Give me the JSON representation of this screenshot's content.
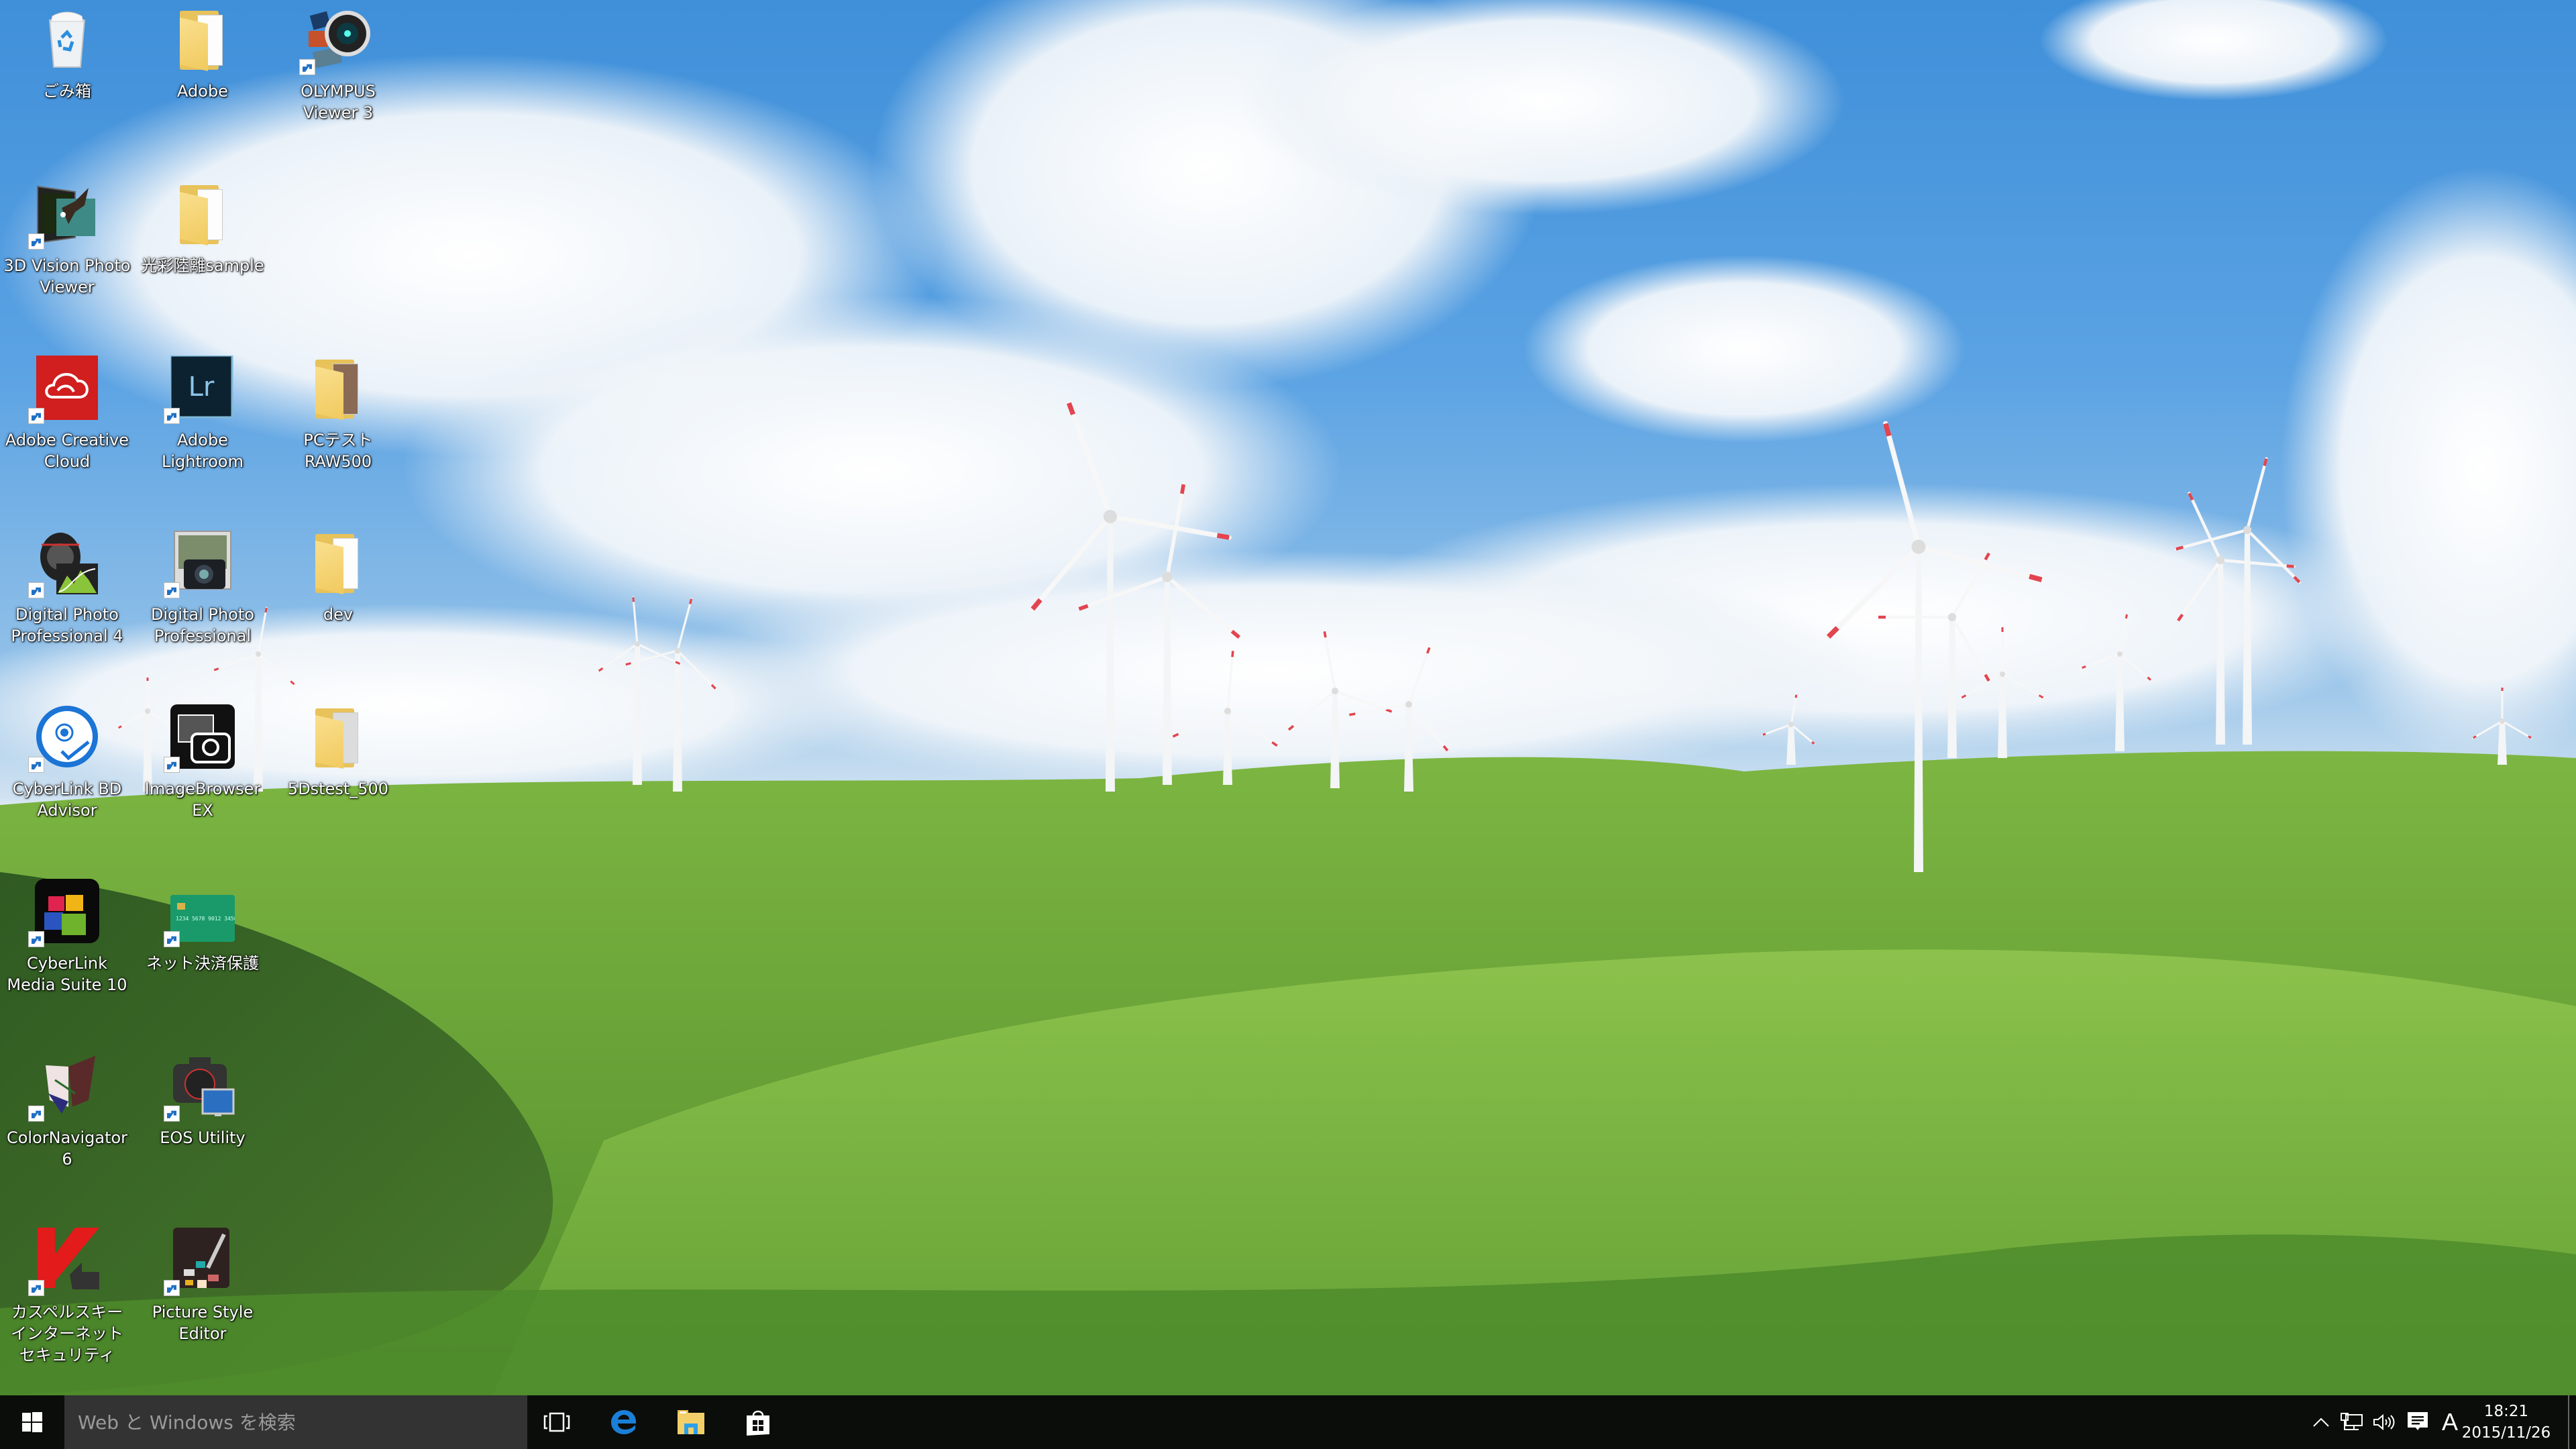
{
  "colors": {
    "taskbar_bg": "#0b0d0a",
    "search_bg": "#333333",
    "accent_blue": "#0078d7",
    "sky": "#5aa2e3",
    "grass": "#6ba53a"
  },
  "desktop": {
    "icons": [
      {
        "label": "ごみ箱",
        "icon": "recycle-bin-icon",
        "shortcut": false
      },
      {
        "label": "Adobe",
        "icon": "folder-icon",
        "shortcut": false
      },
      {
        "label": "OLYMPUS Viewer 3",
        "icon": "olympus-viewer-icon",
        "shortcut": true
      },
      {
        "label": "3D Vision Photo Viewer",
        "icon": "3d-vision-icon",
        "shortcut": true
      },
      {
        "label": "光彩陸離sample",
        "icon": "folder-icon",
        "shortcut": false
      },
      {
        "label": "Adobe Creative Cloud",
        "icon": "creative-cloud-icon",
        "shortcut": true
      },
      {
        "label": "Adobe Lightroom",
        "icon": "lightroom-icon",
        "shortcut": true
      },
      {
        "label": "PCテストRAW500",
        "icon": "photo-folder-icon",
        "shortcut": false
      },
      {
        "label": "Digital Photo Professional 4",
        "icon": "dpp4-icon",
        "shortcut": true
      },
      {
        "label": "Digital Photo Professional",
        "icon": "dpp-icon",
        "shortcut": true
      },
      {
        "label": "dev",
        "icon": "folder-icon",
        "shortcut": false
      },
      {
        "label": "CyberLink BD Advisor",
        "icon": "bd-advisor-icon",
        "shortcut": true
      },
      {
        "label": "ImageBrowser EX",
        "icon": "imagebrowser-icon",
        "shortcut": true
      },
      {
        "label": "5Dstest_500",
        "icon": "media-folder-icon",
        "shortcut": false
      },
      {
        "label": "CyberLink Media Suite 10",
        "icon": "media-suite-icon",
        "shortcut": true
      },
      {
        "label": "ネット決済保護",
        "icon": "credit-card-icon",
        "shortcut": true
      },
      {
        "label": "ColorNavigator 6",
        "icon": "butterfly-icon",
        "shortcut": true
      },
      {
        "label": "EOS Utility",
        "icon": "eos-utility-icon",
        "shortcut": true
      },
      {
        "label": "カスペルスキー インターネット セキュリティ",
        "icon": "kaspersky-icon",
        "shortcut": true
      },
      {
        "label": "Picture Style Editor",
        "icon": "picture-style-icon",
        "shortcut": true
      }
    ]
  },
  "taskbar": {
    "start_icon": "windows-logo-icon",
    "search_placeholder": "Web と Windows を検索",
    "pinned": [
      {
        "name": "task-view",
        "icon": "task-view-icon"
      },
      {
        "name": "edge",
        "icon": "edge-icon"
      },
      {
        "name": "file-explorer",
        "icon": "file-explorer-icon"
      },
      {
        "name": "store",
        "icon": "store-icon"
      }
    ],
    "tray": {
      "ime_label": "A",
      "time": "18:21",
      "date": "2015/11/26"
    }
  }
}
